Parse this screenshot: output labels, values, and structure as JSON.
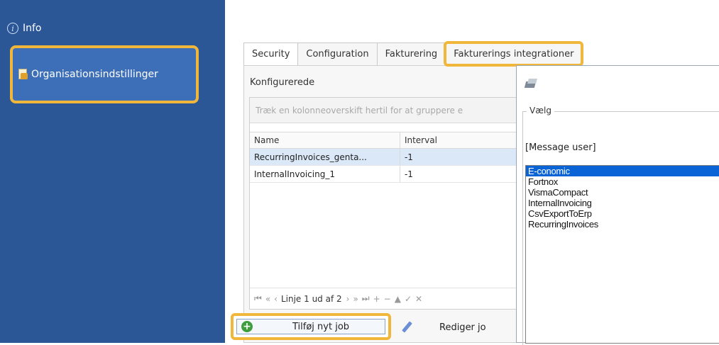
{
  "sidebar": {
    "info_label": "Info",
    "org_label": "Organisationsindstillinger"
  },
  "tabs": [
    {
      "label": "Security"
    },
    {
      "label": "Configuration"
    },
    {
      "label": "Fakturering"
    },
    {
      "label": "Fakturerings integrationer"
    }
  ],
  "panel": {
    "title": "Konfigurerede",
    "group_hint": "Træk en kolonneoverskift hertil for at gruppere e",
    "columns": [
      "Name",
      "Interval"
    ],
    "rows": [
      {
        "name": "RecurringInvoices_genta...",
        "interval": "-1"
      },
      {
        "name": "InternalInvoicing_1",
        "interval": "-1"
      }
    ],
    "navigator": {
      "first": "⏮",
      "prev_page": "«",
      "prev": "‹",
      "position": "Linje 1 ud af 2",
      "next": "›",
      "next_page": "»",
      "last": "⏭",
      "add": "+",
      "remove": "−",
      "up": "▲",
      "ok": "✓",
      "cancel": "✕"
    }
  },
  "buttons": {
    "add_job": "Tilføj nyt job",
    "edit_job": "Rediger jo"
  },
  "dialog": {
    "group_label": "Vælg",
    "message": "[Message user]",
    "options": [
      "E-conomic",
      "Fortnox",
      "VismaCompact",
      "InternalInvoicing",
      "CsvExportToErp",
      "RecurringInvoices"
    ],
    "selected_option": "E-conomic"
  },
  "colors": {
    "sidebar": "#2b5797",
    "highlight": "#f1b73a",
    "selection": "#0a64d6"
  }
}
